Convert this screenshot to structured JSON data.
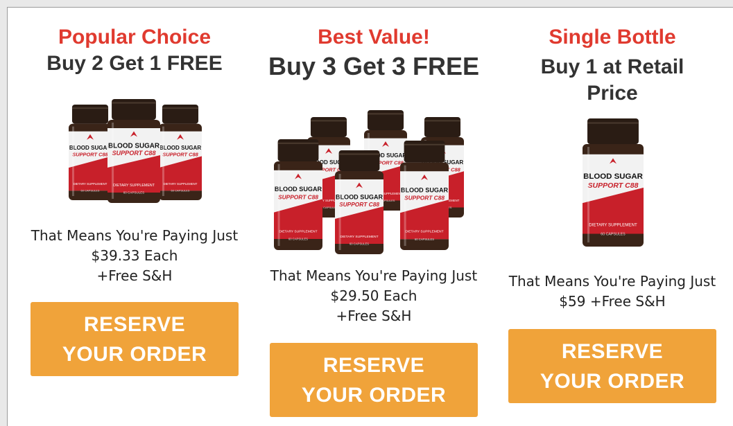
{
  "offers": [
    {
      "tag": "Popular Choice",
      "headline": "Buy 2 Get 1 FREE",
      "price_line1": "That Means You're Paying Just",
      "price_line2": "$39.33 Each",
      "price_line3": "+Free S&H",
      "button": "RESERVE YOUR ORDER",
      "bottles": 3
    },
    {
      "tag": "Best Value!",
      "headline": "Buy 3 Get 3 FREE",
      "price_line1": "That Means You're Paying Just",
      "price_line2": "$29.50 Each",
      "price_line3": "+Free S&H",
      "button": "RESERVE YOUR ORDER",
      "bottles": 6
    },
    {
      "tag": "Single Bottle",
      "headline_line1": "Buy 1 at Retail",
      "headline_line2": "Price",
      "price_line1": "That Means You're Paying Just",
      "price_line2": "$59 +Free S&H",
      "button": "RESERVE YOUR ORDER",
      "bottles": 1
    }
  ],
  "label": {
    "brand_line1": "BLOOD SUGAR",
    "brand_line2": "SUPPORT C88",
    "footer": "DIETARY SUPPLEMENT",
    "capsules": "60 CAPSULES"
  },
  "colors": {
    "accent_red": "#e03a2f",
    "button_orange": "#f0a33a",
    "label_red": "#c8202a",
    "lid_dark": "#2a1c14"
  }
}
